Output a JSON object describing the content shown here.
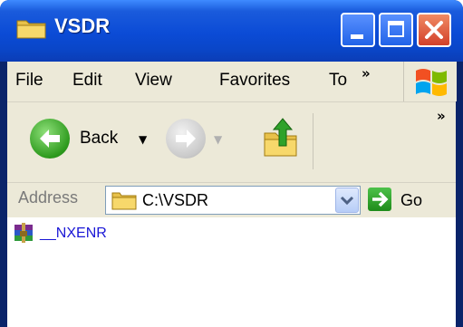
{
  "window": {
    "title": "VSDR",
    "controls": {
      "minimize": "minimize",
      "maximize": "maximize",
      "close": "close"
    }
  },
  "menubar": {
    "items": [
      "File",
      "Edit",
      "View",
      "Favorites",
      "To"
    ],
    "overflow": "»"
  },
  "toolbar": {
    "back_label": "Back",
    "overflow": "»"
  },
  "address": {
    "label": "Address",
    "value": "C:\\VSDR",
    "go_label": "Go"
  },
  "files": [
    {
      "name": "__NXENR",
      "icon": "winrar-archive-icon"
    }
  ]
}
